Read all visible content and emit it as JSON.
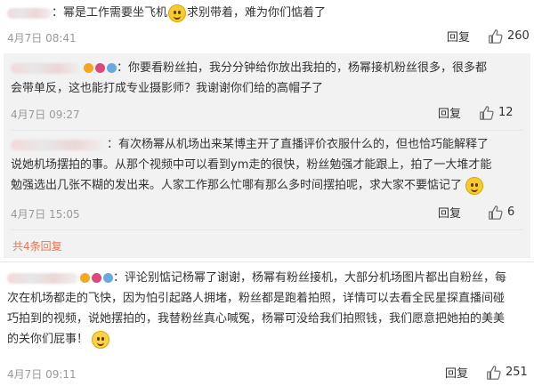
{
  "comments": [
    {
      "text": "：幂是工作需要坐飞机",
      "text2": "求别带着，难为你们惦着了",
      "date": "4月7日 08:41",
      "reply": "回复",
      "likes": "260"
    }
  ],
  "sub_comments": [
    {
      "text_line1": "：你要看粉丝拍，我分分钟给你放出我拍的，杨幂接机粉丝很多，很多都",
      "text_line2": "会带单反，这也能打成专业摄影师？我谢谢你们给的高帽子了",
      "date": "4月7日 09:27",
      "reply": "回复",
      "likes": "12"
    },
    {
      "text_line1": "：有次杨幂从机场出来某博主开了直播评价衣服什么的，但也恰巧能解释了",
      "text_line2": "说她机场摆拍的事。从那个视频中可以看到ym走的很快，粉丝勉强才能跟上，拍了一大堆才能",
      "text_line3": "勉强选出几张不糊的发出来。人家工作那么忙哪有那么多时间摆拍呢，求大家不要惦记了",
      "date": "4月7日 15:05",
      "reply": "回复",
      "likes": "6"
    }
  ],
  "more_replies": "共4条回复",
  "last_comment": {
    "text_line1": "：评论别惦记杨幂了谢谢，杨幂有粉丝接机，大部分机场图片都出自粉丝，每",
    "text_line2": "次在机场都走的飞快，因为怕引起路人拥堵，粉丝都是跑着拍照，详情可以去看全民星探直播间碰",
    "text_line3": "巧拍到的视频，说她摆拍的，我替粉丝真心喊冤，杨幂可没给我们拍照钱，我们愿意把她拍的美美",
    "text_line4": "的关你们屁事！",
    "date": "4月7日 09:11",
    "reply": "回复",
    "likes": "251"
  },
  "colors": {
    "sub_bg": "#f2f2f2",
    "accent": "#eb7350",
    "meta": "#999999"
  },
  "icons": [
    "thumbs-up-icon",
    "smile-emoji",
    "awkward-smile-emoji"
  ]
}
